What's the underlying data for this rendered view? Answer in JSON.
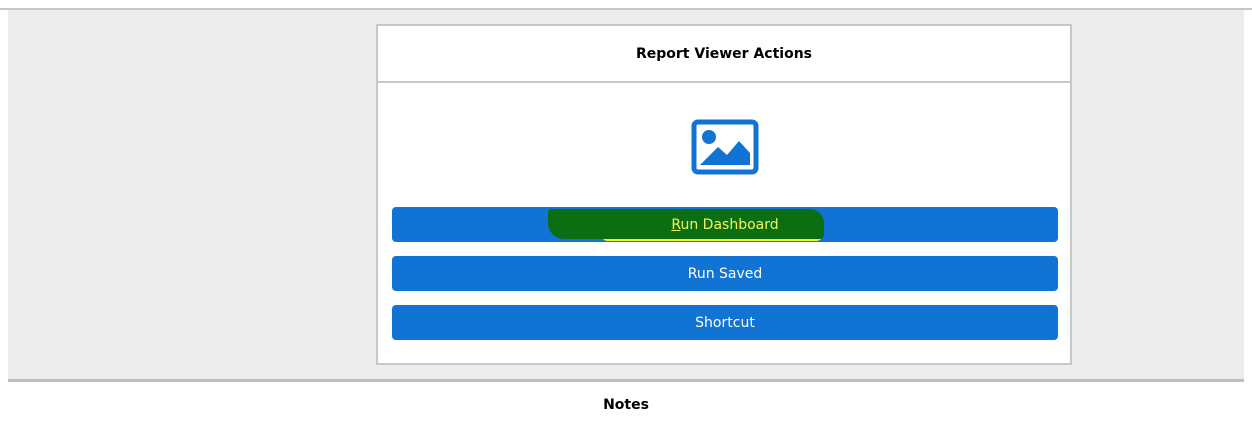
{
  "panel": {
    "title": "Report Viewer Actions",
    "icon": "image-icon",
    "buttons": [
      {
        "label_mnemonic": "R",
        "label_rest": "un Dashboard",
        "highlighted": true
      },
      {
        "label": "Run Saved"
      },
      {
        "label": "Shortcut"
      }
    ]
  },
  "notes": {
    "label": "Notes"
  },
  "colors": {
    "button_blue": "#1173d4",
    "band_gray": "#ececec",
    "highlight_green": "#0c6e12",
    "highlight_yellow": "#f2f22a"
  }
}
